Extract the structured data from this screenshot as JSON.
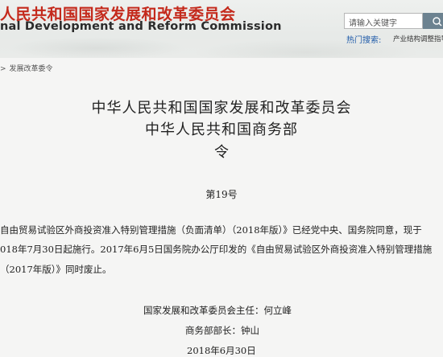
{
  "header": {
    "title_cn": "人民共和国国家发展和改革委员会",
    "title_en": "nal Development and Reform Commission",
    "search_placeholder": "请输入关键字",
    "hot_label": "热门搜索:",
    "hot_item": "产业结构调整指导"
  },
  "breadcrumb": {
    "separator": ">",
    "current": "发展改革委令"
  },
  "document": {
    "issuer_1": "中华人民共和国国家发展和改革委员会",
    "issuer_2": "中华人民共和国商务部",
    "type": "令",
    "number": "第19号",
    "body_line_1": "自由贸易试验区外商投资准入特别管理措施（负面清单）（2018年版）》已经党中央、国务院同意，现于",
    "body_line_2": "018年7月30日起施行。2017年6月5日国务院办公厅印发的《自由贸易试验区外商投资准入特别管理措施",
    "body_line_3": "（2017年版）》同时废止。",
    "signature_1": "国家发展和改革委员会主任：何立峰",
    "signature_2": "商务部部长：钟山",
    "date": "2018年6月30日"
  },
  "colors": {
    "brand_red": "#c42a1c",
    "link_blue": "#1e5aa8",
    "search_button": "#6c8290"
  }
}
